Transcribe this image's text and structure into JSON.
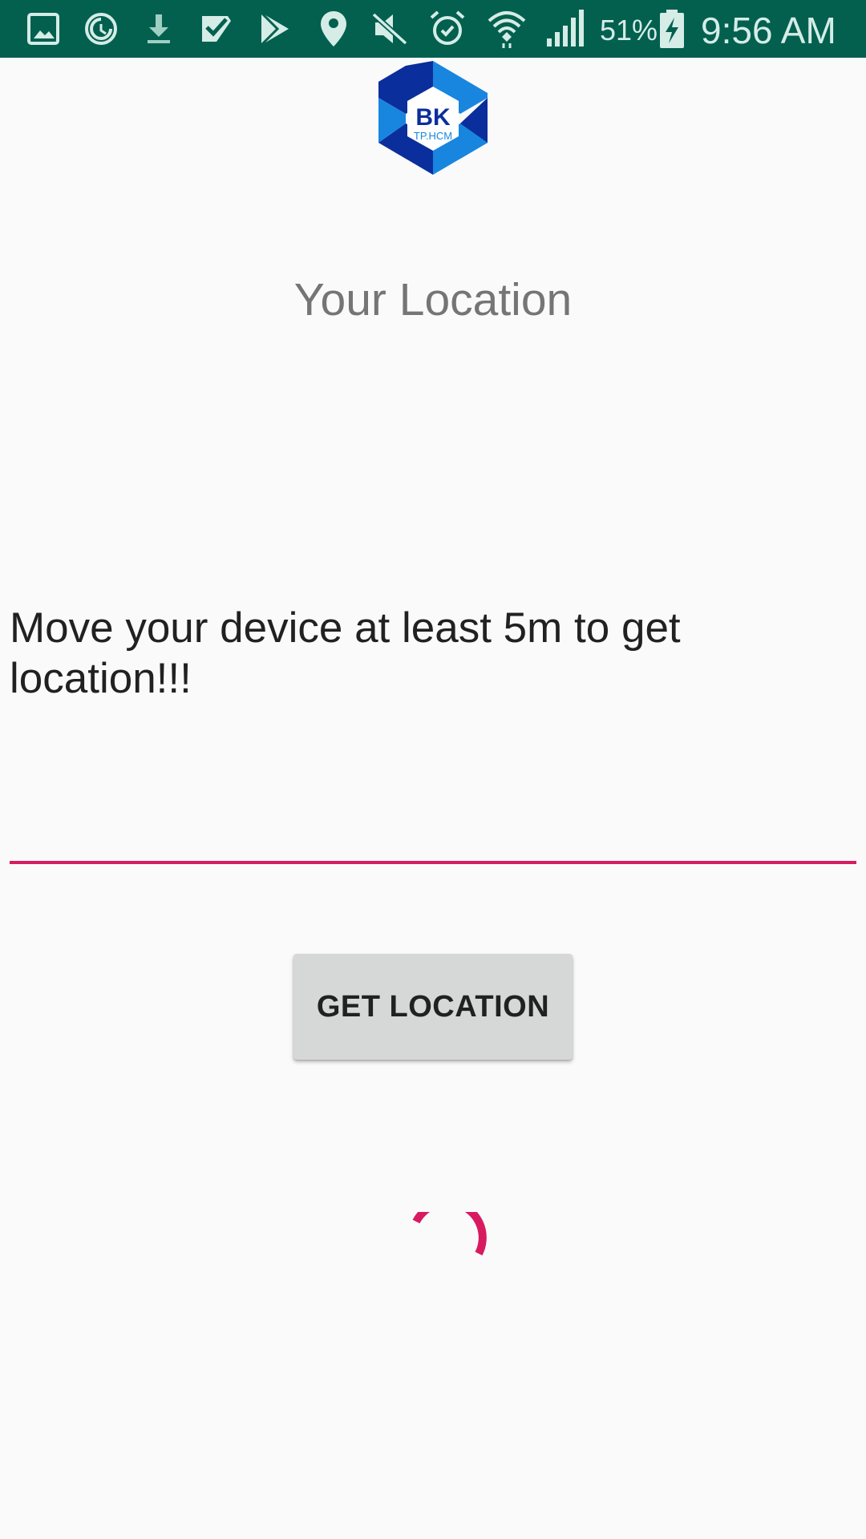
{
  "status_bar": {
    "battery_percent": "51%",
    "time": "9:56 AM",
    "icons": [
      "gallery-icon",
      "sync-icon",
      "download-icon",
      "check-icon",
      "play-store-icon",
      "location-icon",
      "mute-icon",
      "alarm-icon",
      "wifi-icon",
      "signal-icon",
      "battery-charging-icon"
    ]
  },
  "logo": {
    "main_text": "BK",
    "sub_text": "TP.HCM",
    "colors": {
      "dark_blue": "#0a2e9c",
      "light_blue": "#1886df"
    }
  },
  "page": {
    "title": "Your Location",
    "message": "Move your device at least 5m to get location!!!"
  },
  "location_field": {
    "value": "",
    "placeholder": ""
  },
  "actions": {
    "get_location_label": "GET LOCATION"
  },
  "theme": {
    "status_bar_color": "#03604f",
    "accent_color": "#d81b60",
    "background": "#fafafa"
  }
}
